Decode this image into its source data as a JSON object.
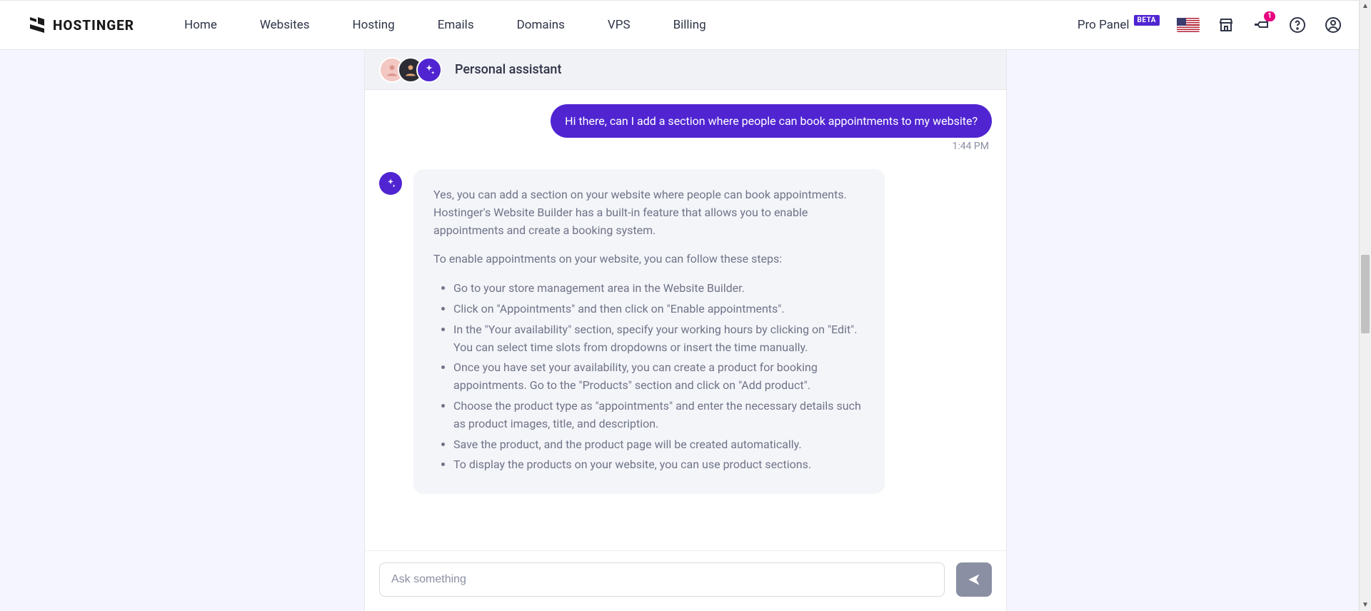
{
  "brand": "HOSTINGER",
  "nav": {
    "home": "Home",
    "websites": "Websites",
    "hosting": "Hosting",
    "emails": "Emails",
    "domains": "Domains",
    "vps": "VPS",
    "billing": "Billing"
  },
  "proPanel": {
    "label": "Pro Panel",
    "badge": "BETA"
  },
  "notifications": {
    "count": "1"
  },
  "chat": {
    "title": "Personal assistant",
    "userMessage": "Hi there, can I add a section where people can book appointments to my website?",
    "timestamp": "1:44 PM",
    "assistant": {
      "intro": "Yes, you can add a section on your website where people can book appointments. Hostinger's Website Builder has a built-in feature that allows you to enable appointments and create a booking system.",
      "stepsLead": "To enable appointments on your website, you can follow these steps:",
      "steps": [
        "Go to your store management area in the Website Builder.",
        "Click on \"Appointments\" and then click on \"Enable appointments\".",
        "In the \"Your availability\" section, specify your working hours by clicking on \"Edit\". You can select time slots from dropdowns or insert the time manually.",
        "Once you have set your availability, you can create a product for booking appointments. Go to the \"Products\" section and click on \"Add product\".",
        "Choose the product type as \"appointments\" and enter the necessary details such as product images, title, and description.",
        "Save the product, and the product page will be created automatically.",
        "To display the products on your website, you can use product sections."
      ]
    },
    "inputPlaceholder": "Ask something"
  }
}
